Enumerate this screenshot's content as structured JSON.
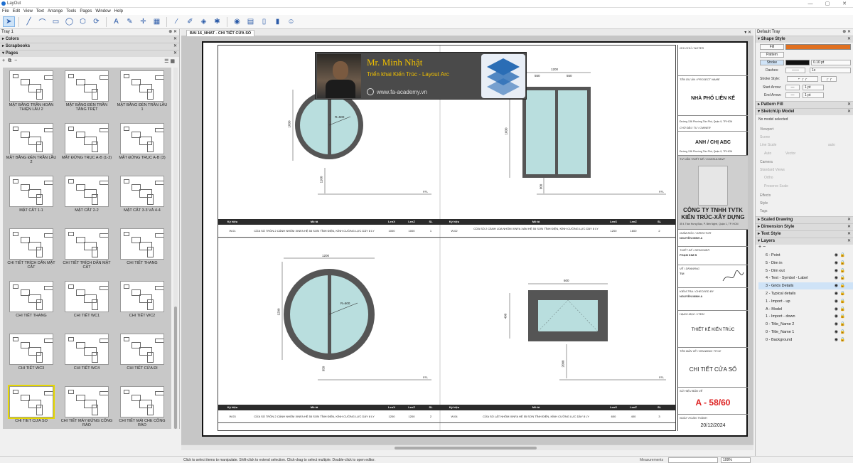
{
  "app": {
    "title": "LayOut",
    "window_controls": [
      "—",
      "▢",
      "✕"
    ]
  },
  "menu": [
    "File",
    "Edit",
    "View",
    "Text",
    "Arrange",
    "Tools",
    "Pages",
    "Window",
    "Help"
  ],
  "toolbar": {
    "icons": [
      "select-icon",
      "line-icon",
      "arc-icon",
      "rectangle-icon",
      "circle-icon",
      "polygon-icon",
      "offset-icon",
      "text-icon",
      "label-icon",
      "dimension-icon",
      "table-icon",
      "eyedropper-icon",
      "paint-icon",
      "erase-icon",
      "style-icon",
      "camera-icon",
      "insert-icon",
      "page-icon",
      "page2-icon",
      "share-icon"
    ]
  },
  "left_tray": {
    "title": "Tray 1",
    "sections": {
      "colors": "Colors",
      "scrapbooks": "Scrapbooks",
      "pages": "Pages"
    },
    "close": "✕",
    "pin": "⊕"
  },
  "pages": [
    {
      "label": "MẶT BẰNG TRẦN HOÀN THIỆN LẦU 2"
    },
    {
      "label": "MẶT BẰNG ĐÈN TRẦN TẦNG TRỆT"
    },
    {
      "label": "MẶT BẰNG ĐÈN TRẦN LẦU 1"
    },
    {
      "label": "MẶT BẰNG ĐÈN TRẦN LẦU 2"
    },
    {
      "label": "MẶT ĐỨNG TRỤC A-B (1-2)"
    },
    {
      "label": "MẶT ĐỨNG TRỤC A-B (3)"
    },
    {
      "label": "MẶT CẮT 1-1"
    },
    {
      "label": "MẶT CẮT 2-2"
    },
    {
      "label": "MẶT CẮT 3-3 VÀ 4-4"
    },
    {
      "label": "CHI TIẾT TRÍCH DẪN MẶT CẮT"
    },
    {
      "label": "CHI TIẾT TRÍCH DẪN MẶT CẮT"
    },
    {
      "label": "CHI TIẾT THANG"
    },
    {
      "label": "CHI TIẾT THANG"
    },
    {
      "label": "CHI TIẾT WC1"
    },
    {
      "label": "CHI TIẾT WC2"
    },
    {
      "label": "CHI TIẾT WC3"
    },
    {
      "label": "CHI TIẾT WC4"
    },
    {
      "label": "CHI TIẾT CỬA ĐI"
    },
    {
      "label": "CHI TIẾT CỬA SỔ"
    },
    {
      "label": "CHI TIẾT MÁY ĐỨNG CÔNG RÀO"
    },
    {
      "label": "CHI TIẾT MÁI CHE CÔNG RÀO"
    }
  ],
  "selected_page": "CHI TIẾT CỬA SỔ",
  "doc": {
    "tab": "BAI 16_NHAT - CHI TIẾT CỬA SỔ",
    "controls": "▾ ✕"
  },
  "drawing": {
    "dims": {
      "w01": "R=500",
      "w02_w": "1200",
      "w02_a": "550",
      "w02_b": "550",
      "h1": "1000",
      "h2": "1100",
      "h3": "1600",
      "h4": "900",
      "w03_w": "1200",
      "w03_r": "R=600",
      "h5": "1200",
      "h6": "950",
      "w04_w": "600",
      "h7": "400",
      "h8": "2000",
      "ffl": "FFL"
    },
    "headers": [
      "Ký hiệu",
      "Mô tả",
      "LenX",
      "LenZ",
      "SL"
    ],
    "row1": [
      {
        "code": "W.01",
        "desc": "CỬA SỔ TRÒN 2 CÁNH NHÔM XINFA HỆ 55 SƠN TĨNH ĐIỆN, KÍNH CƯỜNG LỰC DÀY 8 LY",
        "x": "1000",
        "z": "1000",
        "n": "1"
      },
      {
        "code": "W.02",
        "desc": "CỬA SỔ 2 CÁNH LÙA NHÔM XINFA XÁM HỆ 55 SƠN TĨNH ĐIỆN, KÍNH CƯỜNG LỰC DÀY 8 LY",
        "x": "1200",
        "z": "1600",
        "n": "2"
      }
    ],
    "row2": [
      {
        "code": "W.03",
        "desc": "CỬA SỔ TRÒN 2 CÁNH NHÔM XINFA HỆ 55 SƠN TĨNH ĐIỆN, KÍNH CƯỜNG LỰC DÀY 8 LY",
        "x": "1200",
        "z": "1200",
        "n": "2"
      },
      {
        "code": "W.04",
        "desc": "CỬA SỔ LẬT NHÔM XINFA HỆ 55 SƠN TĨNH ĐIỆN, KÍNH CƯỜNG LỰC DÀY 8 LY",
        "x": "600",
        "z": "400",
        "n": "3"
      }
    ]
  },
  "title_block": {
    "notes": "GHI CHÚ / NOTES",
    "project_lbl": "TÊN DỰ ÁN / PROJECT NAME",
    "project": "NHÀ PHỐ LIÊN KẾ",
    "address": "Đường 136 Phường Tân Phú, Quận 9, TP.HCM",
    "owner_lbl": "CHỦ ĐẦU TƯ / OWNER",
    "owner": "ANH / CHỊ ABC",
    "address2": "Đường 136 Phường Tân Phú, Quận 9, TP.HCM",
    "consult_lbl": "TƯ VẤN THIẾT KẾ / CONSULTANT",
    "company1": "CÔNG TY TNHH TVTK",
    "company2": "KIẾN TRÚC-XÂY DỰNG",
    "company_addr": "35 Ł Trần Hưng Đạo, P. Bến Nghé, Quận 1, TP. HCM",
    "director_lbl": "GIÁM ĐỐC / DIRECTOR",
    "director": "NGUYỄN MINH A",
    "designer_lbl": "THIẾT KẾ / DESIGNER",
    "designer": "PHẠM KIM B",
    "drawing_lbl": "VẼ / DRAWING",
    "drawer": "TUI",
    "checked_lbl": "KIỂM TRA / CHECKED BY",
    "checker": "NGUYỄN MINH A",
    "item_lbl": "HẠNG MỤC / ITEM",
    "item": "THIẾT KẾ KIẾN TRÚC",
    "dtitle_lbl": "TÊN BẢN VẼ / DRAWING TITLE",
    "dtitle": "CHI TIẾT CỬA SỔ",
    "sheet_lbl": "SỐ HIỆU BẢN VẼ",
    "sheet": "A - 58/60",
    "date_lbl": "NGÀY HOÀN THÀNH",
    "date": "20/12/2024"
  },
  "banner": {
    "name": "Mr. Minh Nhật",
    "sub": "Triển khai Kiến Trúc - Layout Arc",
    "web": "www.fa-academy.vn"
  },
  "right_tray": {
    "title": "Default Tray",
    "shape_style": "Shape Style",
    "fill": "Fill",
    "pattern": "Pattern",
    "stroke": "Stroke",
    "stroke_val": "0.10 pt",
    "dashes": "Dashes:",
    "dash_val": "1x",
    "stroke_style": "Stroke Style:",
    "start_arrow": "Start Arrow:",
    "end_arrow": "End Arrow:",
    "arrow_val": "1 pt",
    "pattern_fill": "Pattern Fill",
    "sketchup": "SketchUp Model",
    "no_model": "No model selected",
    "viewport": "Viewport",
    "scene": "Scene",
    "line_scale": "Line Scale",
    "auto": "auto",
    "auto2": "Auto",
    "vector": "Vector",
    "camera": "Camera",
    "std_views": "Standard Views",
    "ortho": "Ortho",
    "preserve": "Preserve Scale",
    "effects": "Effects",
    "style": "Style",
    "tags": "Tags",
    "scaled": "Scaled Drawing",
    "dim_style": "Dimension Style",
    "text_style": "Text Style",
    "layers": "Layers",
    "fill_color": "#e07020",
    "stroke_color": "#111111",
    "accent": "#1e6fd0"
  },
  "layers": [
    {
      "name": "6 - Point",
      "sel": false
    },
    {
      "name": "5 - Dim in",
      "sel": false
    },
    {
      "name": "5 - Dim out",
      "sel": false
    },
    {
      "name": "4 - Text - Symbol - Label",
      "sel": false
    },
    {
      "name": "3 - Grids Details",
      "sel": true
    },
    {
      "name": "2 - Typical details",
      "sel": false
    },
    {
      "name": "1 - Import - up",
      "sel": false
    },
    {
      "name": "A - Model",
      "sel": false
    },
    {
      "name": "1 - Import - down",
      "sel": false
    },
    {
      "name": "0 - Title_Name 2",
      "sel": false
    },
    {
      "name": "0 - Title_Name 1",
      "sel": false
    },
    {
      "name": "0 - Background",
      "sel": false
    }
  ],
  "status": {
    "text": "Click to select items to manipulate. Shift-click to extend selection. Click-drag to select multiple. Double-click to open editor.",
    "measurements": "Measurements",
    "zoom": "109%"
  }
}
